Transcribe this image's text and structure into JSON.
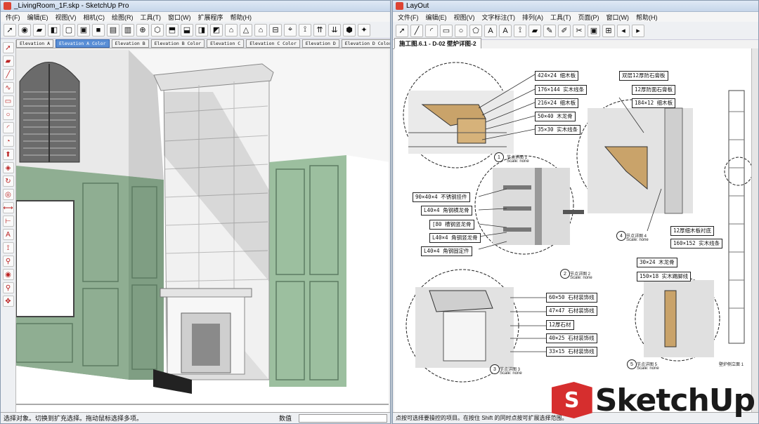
{
  "sketchup": {
    "title": "_LivingRoom_1F.skp - SketchUp Pro",
    "menu": [
      "件(F)",
      "编辑(E)",
      "视图(V)",
      "相机(C)",
      "绘图(R)",
      "工具(T)",
      "窗口(W)",
      "扩展程序",
      "帮助(H)"
    ],
    "scenes": [
      "Elevation A",
      "Elevation A Color",
      "Elevation B",
      "Elevation B Color",
      "Elevation C",
      "Elevation C Color",
      "Elevation D",
      "Elevation D Color"
    ],
    "active_scene": 1,
    "status": "选择对象。切换到扩充选择。拖动鼠标选择多项。",
    "measurements_label": "数值"
  },
  "layout": {
    "title": "LayOut",
    "menu": [
      "文件(F)",
      "编辑(E)",
      "视图(V)",
      "文字标注(T)",
      "排列(A)",
      "工具(T)",
      "页面(P)",
      "窗口(W)",
      "帮助(H)"
    ],
    "tab": "施工图.6.1 - D-02 壁炉详图-2",
    "callouts": {
      "c1": "424×24 细木板",
      "c2": "176×144 实木线条",
      "c3": "216×24 细木板",
      "c4": "50×40 木龙骨",
      "c5": "35×30 实木线条",
      "c6": "双层12厚防石膏板",
      "c7": "12厚防面石膏板",
      "c8": "184×12 细木板",
      "c9": "90×40×4 不锈钢挂件",
      "c10": "L40×4 角钢横龙骨",
      "c11": "[80 槽钢竖龙骨",
      "c12": "L40×4 角钢竖龙骨",
      "c13": "L40×4 角钢固定件",
      "c14": "12厚细木板衬底",
      "c15": "160×152 实木线条",
      "c16": "30×24 木龙骨",
      "c17": "150×18 实木踢脚线",
      "c18": "60×50 石材装饰线",
      "c19": "47×47 石材装饰线",
      "c20": "12厚石材",
      "c21": "40×25 石材装饰线",
      "c22": "33×15 石材装饰线"
    },
    "captions": {
      "cap1": "节点详图 1",
      "cap2": "节点详图 2",
      "cap3": "节点详图 3",
      "cap4": "节点详图 4",
      "cap5": "节点详图 5",
      "cap6": "壁炉侧立面 1",
      "scale": "Scale: none"
    },
    "nums": [
      "1",
      "2",
      "3",
      "4",
      "5"
    ],
    "status": "点按可选择要操控的项目。在按住 Shift 的同时点按可扩展选择范围。"
  },
  "brand": {
    "letter": "S",
    "text": "SketchUp"
  },
  "colors": {
    "panel": "#8fae92",
    "panel_dark": "#6f8f74",
    "wood": "#c9a36a"
  }
}
